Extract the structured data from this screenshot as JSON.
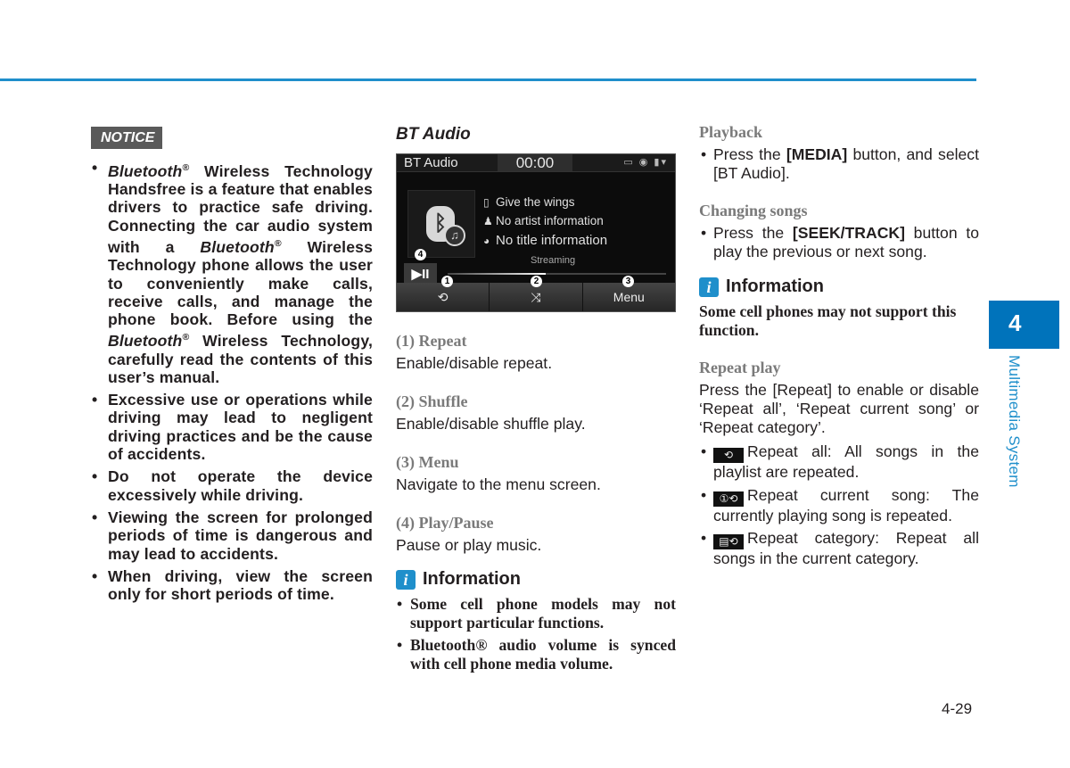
{
  "notice": {
    "badge": "NOTICE",
    "items": [
      {
        "parts": [
          [
            "i",
            "Bluetooth"
          ],
          [
            "sup",
            "®"
          ],
          [
            "t",
            " Wireless Technology Handsfree is a feature that enables drivers to practice safe driving. Connecting the car audio system with a "
          ],
          [
            "i",
            "Bluetooth"
          ],
          [
            "sup",
            "®"
          ],
          [
            "t",
            " Wireless Technology phone allows the user to conveniently make calls, receive calls, and manage the phone book. Before using the "
          ],
          [
            "i",
            "Bluetooth"
          ],
          [
            "sup",
            "®"
          ],
          [
            "t",
            " Wireless Technology, carefully read the contents of this user’s manual."
          ]
        ]
      },
      {
        "parts": [
          [
            "t",
            "Excessive use or operations while driving may lead to negligent driving practices and be the cause of accidents."
          ]
        ]
      },
      {
        "parts": [
          [
            "t",
            "Do not operate the device excessively while driving."
          ]
        ]
      },
      {
        "parts": [
          [
            "t",
            "Viewing the screen for prolonged periods of time is dangerous and may lead to accidents."
          ]
        ]
      },
      {
        "parts": [
          [
            "t",
            "When driving, view the screen only for short periods of time."
          ]
        ]
      }
    ]
  },
  "bt_audio": {
    "heading": "BT Audio",
    "screen": {
      "title": "BT Audio",
      "time": "00:00",
      "status_icons": "▭ ◉ ▮▾",
      "track_device": "Give the wings",
      "track_artist": "No artist information",
      "track_title": "No title information",
      "status": "Streaming",
      "progress": 0.45,
      "play_pause": "▶II",
      "buttons": [
        {
          "label": "⟲",
          "callout": "1"
        },
        {
          "label": "⤨",
          "callout": "2"
        },
        {
          "label": "Menu",
          "callout": "3"
        }
      ],
      "play_callout": "4"
    },
    "sections": [
      {
        "title": "(1) Repeat",
        "text": "Enable/disable repeat."
      },
      {
        "title": "(2) Shuffle",
        "text": "Enable/disable shuffle play."
      },
      {
        "title": "(3) Menu",
        "text": "Navigate to the menu screen."
      },
      {
        "title": "(4) Play/Pause",
        "text": "Pause or play music."
      }
    ],
    "info": {
      "title": "Information",
      "items": [
        "Some cell phone models may not support particular functions.",
        "Bluetooth® audio volume is synced with cell phone media volume."
      ]
    }
  },
  "right": {
    "playback": {
      "title": "Playback",
      "pre": "Press the ",
      "bold": "[MEDIA]",
      "post": " button, and select [BT Audio]."
    },
    "changing": {
      "title": "Changing songs",
      "pre": "Press the ",
      "bold": "[SEEK/TRACK]",
      "post": " button to play the previous or next song."
    },
    "info": {
      "title": "Information",
      "text": "Some cell phones may not support this function."
    },
    "repeat_play": {
      "title": "Repeat play",
      "text": "Press the [Repeat] to enable or disable ‘Repeat all’, ‘Repeat current song’ or ‘Repeat category’.",
      "items": [
        {
          "icon": "⟲",
          "text": "Repeat all: All songs in the playlist are repeated."
        },
        {
          "icon": "①⟲",
          "text": "Repeat current song: The currently playing song is repeated."
        },
        {
          "icon": "▤⟲",
          "text": "Repeat category: Repeat all songs in the current category."
        }
      ]
    }
  },
  "side": {
    "chapter": "4",
    "label": "Multimedia System"
  },
  "page_number": "4-29",
  "colors": {
    "accent": "#1f8fcb",
    "tab": "#0073bb"
  }
}
